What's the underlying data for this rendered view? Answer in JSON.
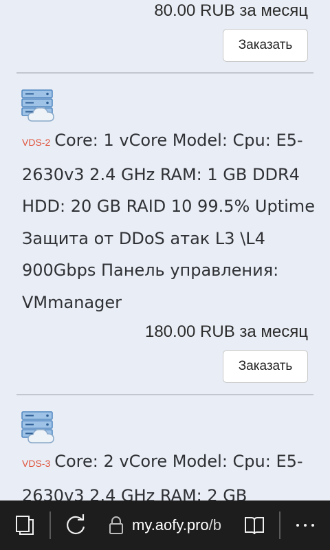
{
  "listing": {
    "top_item": {
      "price": "80.00 RUB за месяц",
      "order_label": "Заказать"
    },
    "items": [
      {
        "tag": "VDS-2",
        "description": "Core: 1 vCore Model: Cpu: E5-2630v3 2.4 GHz RAM: 1 GB DDR4 HDD: 20 GB RAID 10 99.5% Uptime Защита от DDoS атак L3 \\L4 900Gbps Панель управления: VMmanager",
        "price": "180.00 RUB за месяц",
        "order_label": "Заказать"
      },
      {
        "tag": "VDS-3",
        "description": "Core: 2 vCore Model: Cpu: E5-2630v3 2.4 GHz RAM: 2 GB"
      }
    ]
  },
  "browser": {
    "url_host": "my.aofy.pro",
    "url_rest": "/b"
  },
  "colors": {
    "background": "#e9edf5",
    "tag": "#e0523a",
    "toolbar": "#1d1d1d"
  }
}
